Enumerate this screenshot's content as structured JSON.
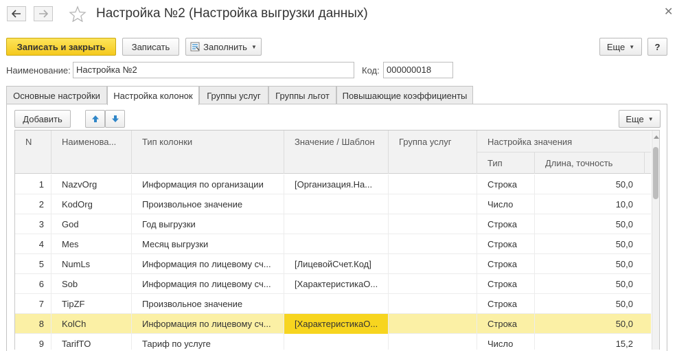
{
  "window": {
    "title": "Настройка №2 (Настройка выгрузки данных)"
  },
  "toolbar": {
    "save_close": "Записать и закрыть",
    "save": "Записать",
    "fill": "Заполнить",
    "more": "Еще",
    "help": "?"
  },
  "form": {
    "name_label": "Наименование:",
    "name_value": "Настройка №2",
    "code_label": "Код:",
    "code_value": "000000018"
  },
  "tabs": [
    {
      "label": "Основные настройки"
    },
    {
      "label": "Настройка колонок"
    },
    {
      "label": "Группы услуг"
    },
    {
      "label": "Группы льгот"
    },
    {
      "label": "Повышающие коэффициенты"
    }
  ],
  "table_toolbar": {
    "add": "Добавить",
    "more": "Еще"
  },
  "table": {
    "headers": {
      "n": "N",
      "name": "Наименова...",
      "col_type": "Тип колонки",
      "value": "Значение / Шаблон",
      "group": "Группа услуг",
      "setting": "Настройка значения",
      "type": "Тип",
      "length": "Длина, точность"
    },
    "rows": [
      {
        "n": "1",
        "name": "NazvOrg",
        "col_type": "Информация по организации",
        "value": "[Организация.На...",
        "group": "",
        "type": "Строка",
        "length": "50,0"
      },
      {
        "n": "2",
        "name": "KodOrg",
        "col_type": "Произвольное значение",
        "value": "",
        "group": "",
        "type": "Число",
        "length": "10,0"
      },
      {
        "n": "3",
        "name": "God",
        "col_type": "Год выгрузки",
        "value": "",
        "group": "",
        "type": "Строка",
        "length": "50,0"
      },
      {
        "n": "4",
        "name": "Mes",
        "col_type": "Месяц выгрузки",
        "value": "",
        "group": "",
        "type": "Строка",
        "length": "50,0"
      },
      {
        "n": "5",
        "name": "NumLs",
        "col_type": "Информация по лицевому сч...",
        "value": "[ЛицевойСчет.Код]",
        "group": "",
        "type": "Строка",
        "length": "50,0"
      },
      {
        "n": "6",
        "name": "Sob",
        "col_type": "Информация по лицевому сч...",
        "value": "[ХарактеристикаО...",
        "group": "",
        "type": "Строка",
        "length": "50,0"
      },
      {
        "n": "7",
        "name": "TipZF",
        "col_type": "Произвольное значение",
        "value": "",
        "group": "",
        "type": "Строка",
        "length": "50,0"
      },
      {
        "n": "8",
        "name": "KolCh",
        "col_type": "Информация по лицевому сч...",
        "value": "[ХарактеристикаО...",
        "group": "",
        "type": "Строка",
        "length": "50,0"
      },
      {
        "n": "9",
        "name": "TarifTO",
        "col_type": "Тариф по услуге",
        "value": "",
        "group": "",
        "type": "Число",
        "length": "15,2"
      }
    ],
    "selected_row": 8
  },
  "colors": {
    "primary_button": "#f5c91d",
    "selected_row": "#fbf0a5",
    "selected_cell": "#f7d51f",
    "arrow_blue": "#2f86c8"
  }
}
